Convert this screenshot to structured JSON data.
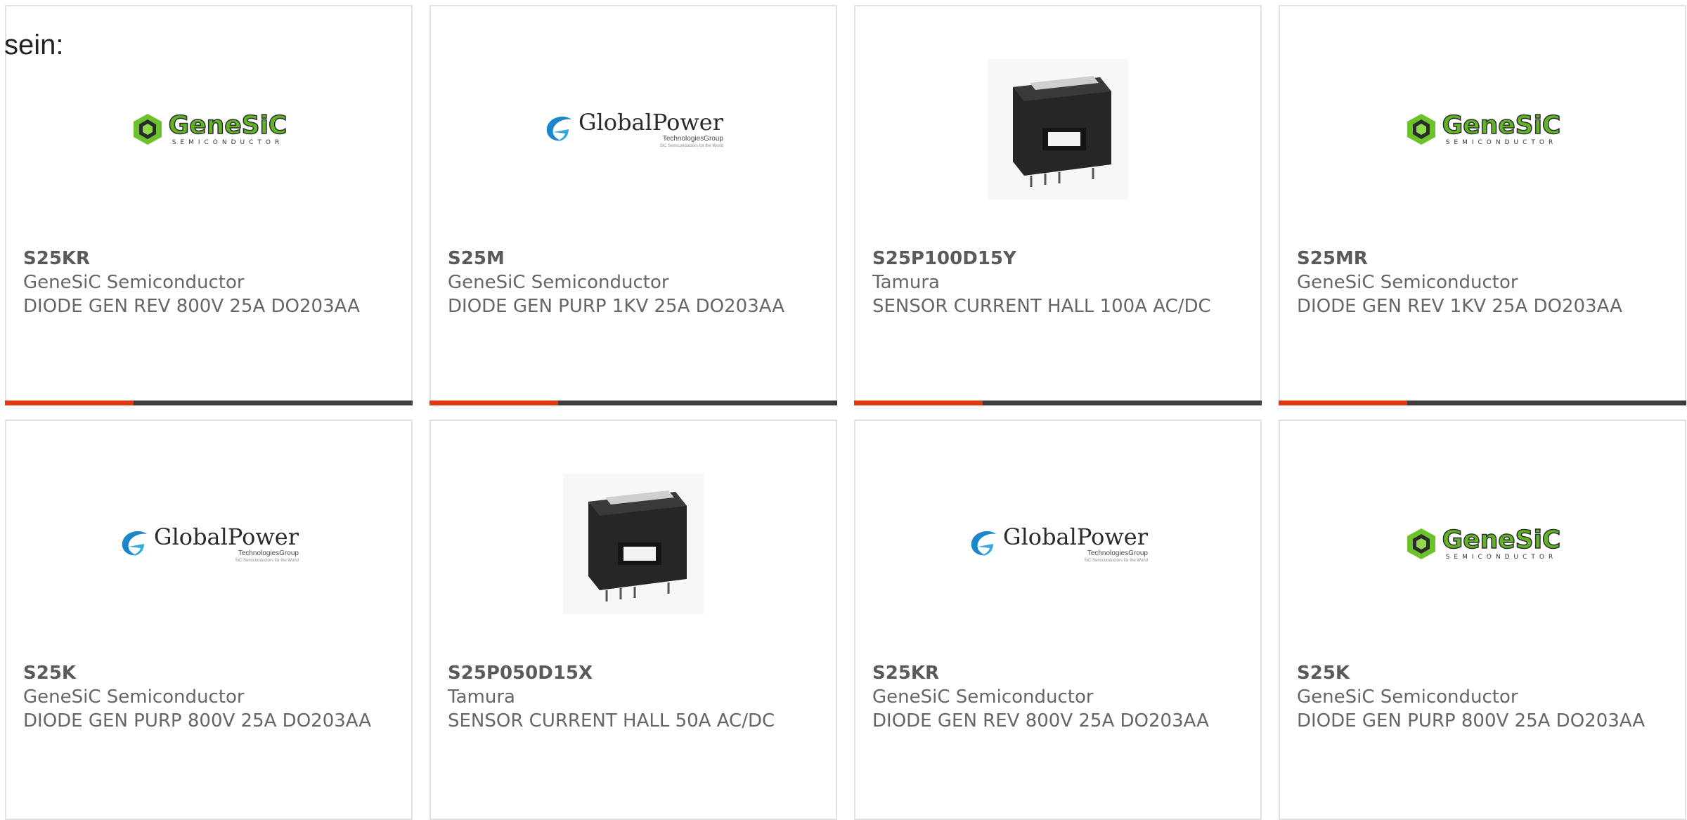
{
  "intro_text": "sein:",
  "logos": {
    "genesic": {
      "word": "GeneSiC",
      "sub": "SEMICONDUCTOR"
    },
    "globalpower": {
      "word": "GlobalPower",
      "sub": "TechnologiesGroup",
      "sub2": "SiC Semiconductors for the World"
    }
  },
  "colors": {
    "accent": "#e03a12",
    "bar": "#3d3d3d",
    "text": "#666666",
    "border": "#e2e2e2"
  },
  "products": [
    {
      "part": "S25KR",
      "manufacturer": "GeneSiC Semiconductor",
      "description": "DIODE GEN REV 800V 25A DO203AA",
      "image": "genesic-logo"
    },
    {
      "part": "S25M",
      "manufacturer": "GeneSiC Semiconductor",
      "description": "DIODE GEN PURP 1KV 25A DO203AA",
      "image": "globalpower-logo"
    },
    {
      "part": "S25P100D15Y",
      "manufacturer": "Tamura",
      "description": "SENSOR CURRENT HALL 100A AC/DC",
      "image": "current-sensor-photo"
    },
    {
      "part": "S25MR",
      "manufacturer": "GeneSiC Semiconductor",
      "description": "DIODE GEN REV 1KV 25A DO203AA",
      "image": "genesic-logo"
    },
    {
      "part": "S25K",
      "manufacturer": "GeneSiC Semiconductor",
      "description": "DIODE GEN PURP 800V 25A DO203AA",
      "image": "globalpower-logo"
    },
    {
      "part": "S25P050D15X",
      "manufacturer": "Tamura",
      "description": "SENSOR CURRENT HALL 50A AC/DC",
      "image": "current-sensor-photo"
    },
    {
      "part": "S25KR",
      "manufacturer": "GeneSiC Semiconductor",
      "description": "DIODE GEN REV 800V 25A DO203AA",
      "image": "globalpower-logo"
    },
    {
      "part": "S25K",
      "manufacturer": "GeneSiC Semiconductor",
      "description": "DIODE GEN PURP 800V 25A DO203AA",
      "image": "genesic-logo"
    }
  ]
}
